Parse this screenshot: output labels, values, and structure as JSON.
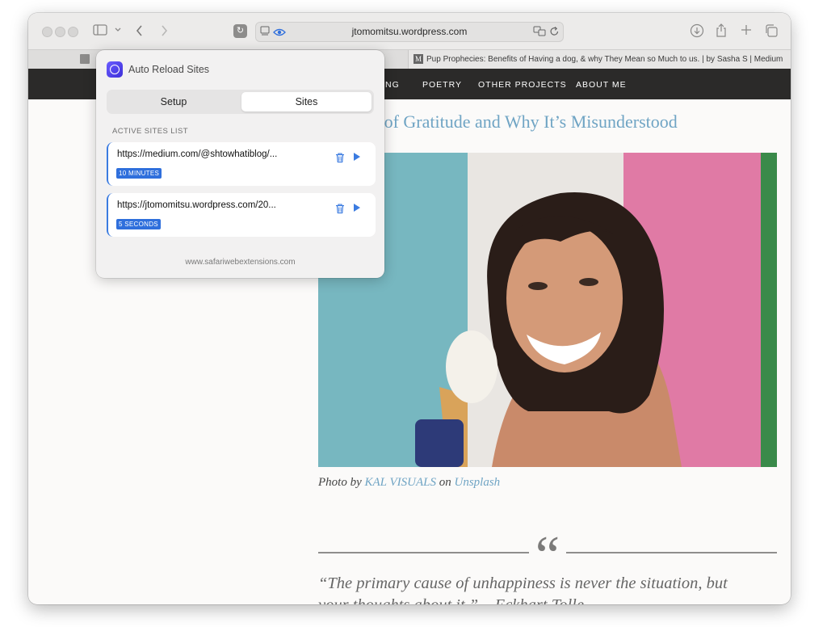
{
  "browser": {
    "address": "jtomomitsu.wordpress.com",
    "tab_label": "Pup Prophecies: Benefits of Having a dog, & why They Mean so Much to us. | by Sasha S | Medium",
    "tab_favicon": "M",
    "reload_extension_glyph": "↻"
  },
  "site": {
    "nav": [
      "NG",
      "POETRY",
      "OTHER PROJECTS",
      "ABOUT ME"
    ],
    "post_title": "er of Gratitude and Why It’s Misunderstood",
    "caption": {
      "prefix": "Photo by ",
      "photographer": "KAL VISUALS",
      "middle": " on ",
      "source": "Unsplash"
    },
    "quote_mark": "“",
    "quote_line1": "“The primary cause of unhappiness is never the situation, but",
    "quote_line2": "your thoughts about it.” – Eckhart Tolle"
  },
  "popover": {
    "title": "Auto Reload Sites",
    "tabs": {
      "setup": "Setup",
      "sites": "Sites"
    },
    "section_label": "ACTIVE SITES LIST",
    "sites": [
      {
        "url": "https://medium.com/@shtowhatiblog/...",
        "interval": "10 MINUTES"
      },
      {
        "url": "https://jtomomitsu.wordpress.com/20...",
        "interval": "5 SECONDS"
      }
    ],
    "footer": "www.safariwebextensions.com"
  },
  "colors": {
    "accent": "#3b7be0",
    "badge": "#2f6fdc",
    "nav_bg": "#2b2a29",
    "link": "#6fa4c4"
  },
  "icons": [
    "sidebar-icon",
    "chevron-down-icon",
    "back-icon",
    "forward-icon",
    "reload-extension-icon",
    "reader-icon",
    "privacy-eye-icon",
    "translate-icon",
    "reload-icon",
    "download-icon",
    "share-icon",
    "new-tab-icon",
    "tabs-overview-icon",
    "trash-icon",
    "play-icon",
    "app-icon"
  ]
}
